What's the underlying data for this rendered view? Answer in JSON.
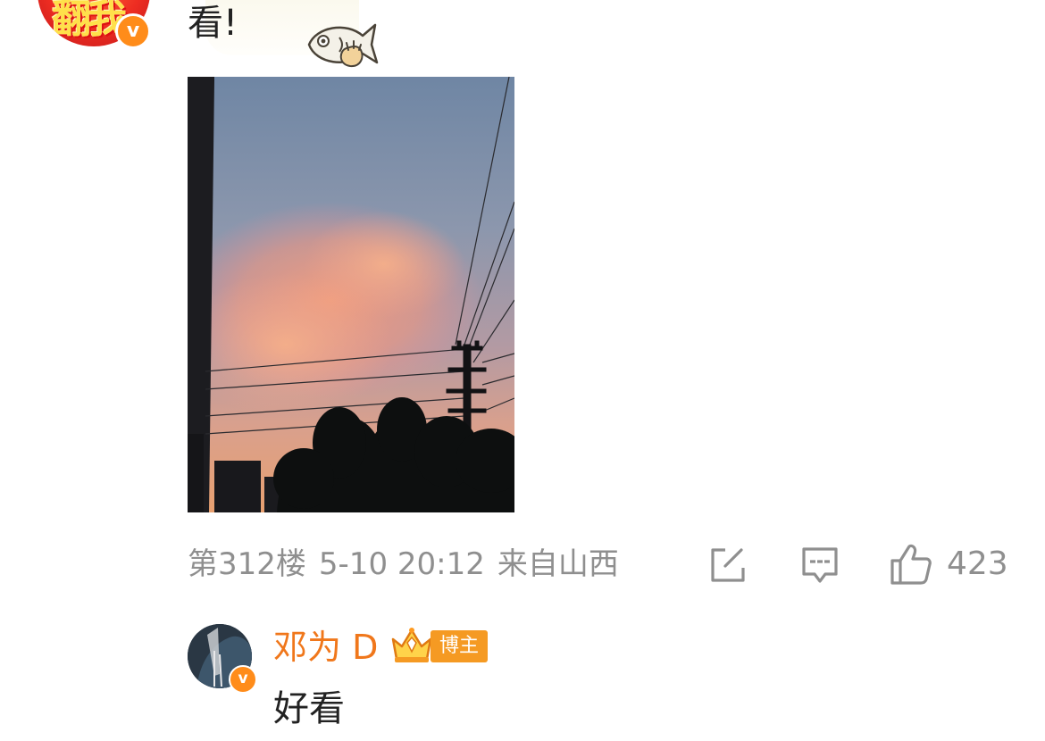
{
  "top_comment": {
    "avatar_text": "翻我",
    "verify_mark": "v",
    "text": "看!",
    "sticker": "fish-sticker",
    "meta": {
      "floor": "第312楼",
      "time": "5-10 20:12",
      "location": "来自山西"
    },
    "actions": {
      "share_icon": "share-icon",
      "reply_icon": "comment-icon",
      "like_icon": "thumbs-up-icon",
      "like_count": "423"
    }
  },
  "reply": {
    "username": "邓为 D",
    "verify_mark": "v",
    "crown_badge": "crown-icon",
    "role_badge": "博主",
    "text": "好看"
  },
  "colors": {
    "username": "#f0771b",
    "meta_gray": "#8f8f8f",
    "badge_orange": "#f59a23",
    "verify_orange": "#ff8c1a"
  }
}
